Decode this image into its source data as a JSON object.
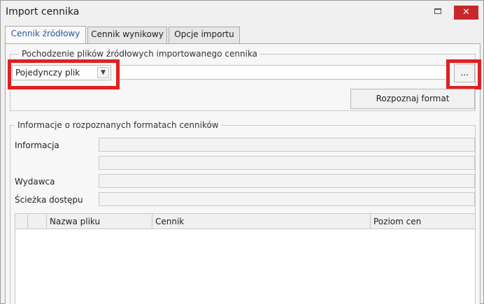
{
  "window": {
    "title": "Import cennika",
    "close_label": "✕"
  },
  "tabs": [
    {
      "label": "Cennik źródłowy"
    },
    {
      "label": "Cennik wynikowy"
    },
    {
      "label": "Opcje importu"
    }
  ],
  "source": {
    "group_label": "Pochodzenie plików źródłowych importowanego cennika",
    "mode_selected": "Pojedynczy plik",
    "path_value": "",
    "browse_label": "...",
    "detect_label": "Rozpoznaj format"
  },
  "info": {
    "group_label": "Informacje o rozpoznanych formatach cenników",
    "info_label": "Informacja",
    "publisher_label": "Wydawca",
    "path_label": "Ścieżka dostępu"
  },
  "grid": {
    "columns": [
      "",
      "",
      "Nazwa pliku",
      "Cennik",
      "Poziom cen"
    ]
  },
  "colors": {
    "accent": "#2b579a",
    "highlight": "#e02020",
    "close": "#c8272c"
  }
}
